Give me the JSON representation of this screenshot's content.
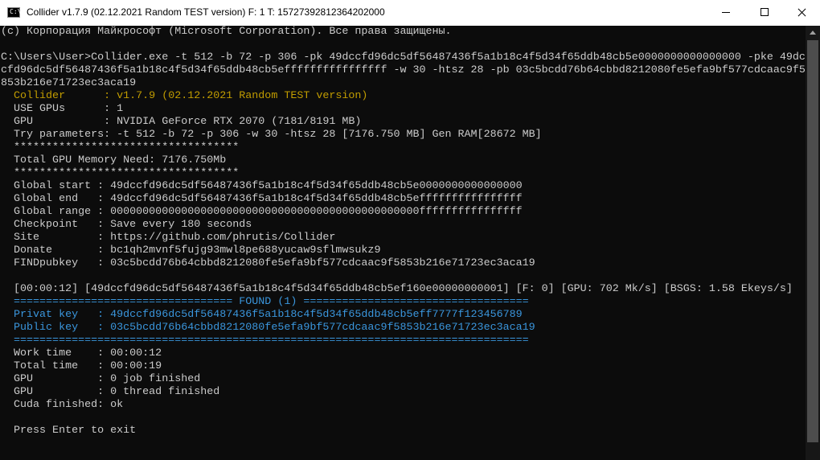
{
  "window": {
    "title": "Collider v1.7.9 (02.12.2021 Random TEST version) F: 1 T: 15727392812364202000",
    "icon": "console-icon",
    "icon_text": "C:\\"
  },
  "console": {
    "lines": [
      {
        "text": "(с) Корпорация Майкрософт (Microsoft Corporation). Все права защищены.",
        "color": "default"
      },
      {
        "text": "",
        "color": "default"
      },
      {
        "text": "C:\\Users\\User>Collider.exe -t 512 -b 72 -p 306 -pk 49dccfd96dc5df56487436f5a1b18c4f5d34f65ddb48cb5e0000000000000000 -pke 49dc",
        "color": "default"
      },
      {
        "text": "cfd96dc5df56487436f5a1b18c4f5d34f65ddb48cb5effffffffffffffff -w 30 -htsz 28 -pb 03c5bcdd76b64cbbd8212080fe5efa9bf577cdcaac9f5",
        "color": "default"
      },
      {
        "text": "853b216e71723ec3aca19",
        "color": "default"
      },
      {
        "text": "  Collider      : v1.7.9 (02.12.2021 Random TEST version)",
        "color": "yellow"
      },
      {
        "text": "  USE GPUs      : 1",
        "color": "default"
      },
      {
        "text": "  GPU           : NVIDIA GeForce RTX 2070 (7181/8191 MB)",
        "color": "default"
      },
      {
        "text": "  Try parameters: -t 512 -b 72 -p 306 -w 30 -htsz 28 [7176.750 MB] Gen RAM[28672 MB]",
        "color": "default"
      },
      {
        "text": "  ***********************************",
        "color": "default"
      },
      {
        "text": "  Total GPU Memory Need: 7176.750Mb",
        "color": "default"
      },
      {
        "text": "  ***********************************",
        "color": "default"
      },
      {
        "text": "  Global start : 49dccfd96dc5df56487436f5a1b18c4f5d34f65ddb48cb5e0000000000000000",
        "color": "default"
      },
      {
        "text": "  Global end   : 49dccfd96dc5df56487436f5a1b18c4f5d34f65ddb48cb5effffffffffffffff",
        "color": "default"
      },
      {
        "text": "  Global range : 000000000000000000000000000000000000000000000000ffffffffffffffff",
        "color": "default"
      },
      {
        "text": "  Checkpoint   : Save every 180 seconds",
        "color": "default"
      },
      {
        "text": "  Site         : https://github.com/phrutis/Collider",
        "color": "default"
      },
      {
        "text": "  Donate       : bc1qh2mvnf5fujg93mwl8pe688yucaw9sflmwsukz9",
        "color": "default"
      },
      {
        "text": "  FINDpubkey   : 03c5bcdd76b64cbbd8212080fe5efa9bf577cdcaac9f5853b216e71723ec3aca19",
        "color": "default"
      },
      {
        "text": "",
        "color": "default"
      },
      {
        "text": "  [00:00:12] [49dccfd96dc5df56487436f5a1b18c4f5d34f65ddb48cb5ef160e00000000001] [F: 0] [GPU: 702 Mk/s] [BSGS: 1.58 Ekeys/s]",
        "color": "default"
      },
      {
        "text": "  ================================== FOUND (1) ===================================",
        "color": "cyan"
      },
      {
        "text": "  Privat key   : 49dccfd96dc5df56487436f5a1b18c4f5d34f65ddb48cb5eff7777f123456789",
        "color": "cyan"
      },
      {
        "text": "  Public key   : 03c5bcdd76b64cbbd8212080fe5efa9bf577cdcaac9f5853b216e71723ec3aca19",
        "color": "cyan"
      },
      {
        "text": "  ================================================================================",
        "color": "cyan"
      },
      {
        "text": "  Work time    : 00:00:12",
        "color": "default"
      },
      {
        "text": "  Total time   : 00:00:19",
        "color": "default"
      },
      {
        "text": "  GPU          : 0 job finished",
        "color": "default"
      },
      {
        "text": "  GPU          : 0 thread finished",
        "color": "default"
      },
      {
        "text": "  Cuda finished: ok",
        "color": "default"
      },
      {
        "text": "",
        "color": "default"
      },
      {
        "text": "  Press Enter to exit",
        "color": "default"
      }
    ]
  },
  "colors": {
    "default": "#cccccc",
    "yellow": "#c19c00",
    "cyan": "#3a96dd",
    "background": "#0c0c0c"
  }
}
